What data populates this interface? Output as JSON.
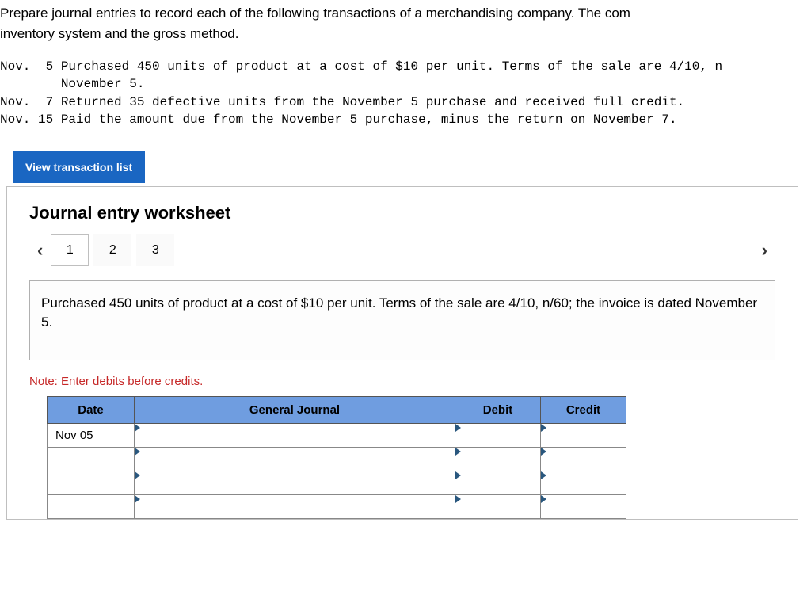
{
  "intro": "Prepare journal entries to record each of the following transactions of a merchandising company. The comp inventory system and the gross method.",
  "intro_line1": "Prepare journal entries to record each of the following transactions of a merchandising company. The com",
  "intro_line2": "inventory system and the gross method.",
  "transactions": {
    "l1": "Nov.  5 Purchased 450 units of product at a cost of $10 per unit. Terms of the sale are 4/10, n",
    "l2": "        November 5.",
    "l3": "Nov.  7 Returned 35 defective units from the November 5 purchase and received full credit.",
    "l4": "Nov. 15 Paid the amount due from the November 5 purchase, minus the return on November 7."
  },
  "view_button": "View transaction list",
  "worksheet": {
    "title": "Journal entry worksheet",
    "tabs": [
      "1",
      "2",
      "3"
    ],
    "active_tab": 0,
    "description": "Purchased 450 units of product at a cost of $10 per unit. Terms of the sale are 4/10, n/60; the invoice is dated November 5.",
    "note": "Note: Enter debits before credits.",
    "table": {
      "headers": {
        "date": "Date",
        "gj": "General Journal",
        "debit": "Debit",
        "credit": "Credit"
      },
      "rows": [
        {
          "date": "Nov 05",
          "gj": "",
          "debit": "",
          "credit": ""
        },
        {
          "date": "",
          "gj": "",
          "debit": "",
          "credit": ""
        },
        {
          "date": "",
          "gj": "",
          "debit": "",
          "credit": ""
        },
        {
          "date": "",
          "gj": "",
          "debit": "",
          "credit": ""
        }
      ]
    }
  }
}
